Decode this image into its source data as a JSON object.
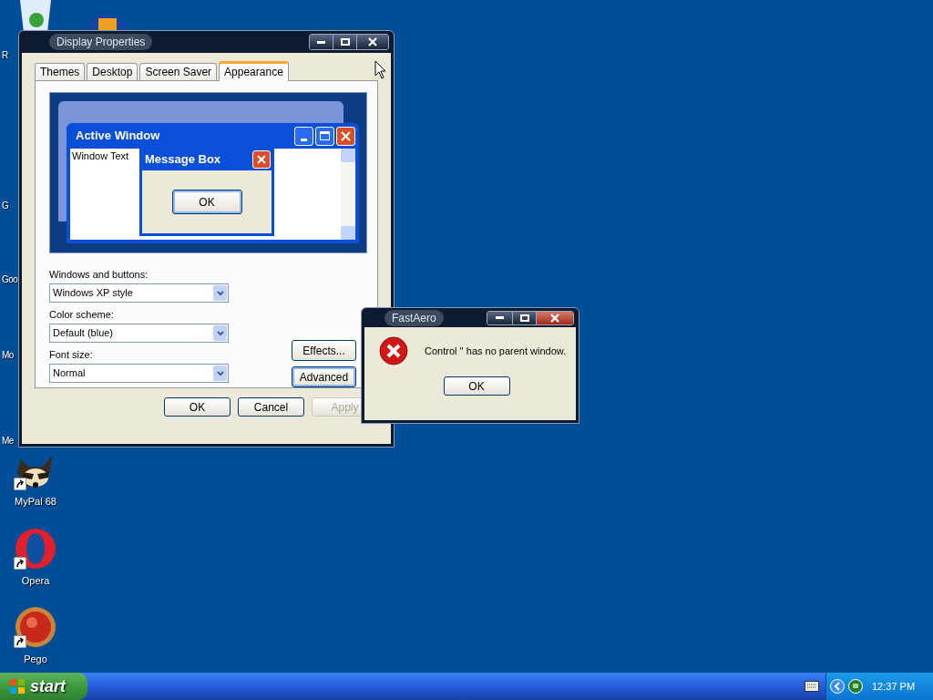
{
  "desktop_icons": [
    {
      "label": "R",
      "kind": "partial"
    },
    {
      "label": "G",
      "kind": "partial"
    },
    {
      "label": "Goo",
      "kind": "partial"
    },
    {
      "label": "Mo",
      "kind": "partial"
    },
    {
      "label": "Me",
      "kind": "partial"
    },
    {
      "label": "MyPal 68",
      "kind": "raccoon"
    },
    {
      "label": "Opera",
      "kind": "opera"
    },
    {
      "label": "Pego",
      "kind": "pego"
    }
  ],
  "display_properties": {
    "title": "Display Properties",
    "tabs": [
      {
        "label": "Themes",
        "selected": false
      },
      {
        "label": "Desktop",
        "selected": false
      },
      {
        "label": "Screen Saver",
        "selected": false
      },
      {
        "label": "Appearance",
        "selected": true
      }
    ],
    "preview": {
      "active_title": "Active Window",
      "window_text": "Window Text",
      "message_box_title": "Message Box",
      "message_box_button": "OK"
    },
    "fields": [
      {
        "label": "Windows and buttons:",
        "value": "Windows XP style"
      },
      {
        "label": "Color scheme:",
        "value": "Default (blue)"
      },
      {
        "label": "Font size:",
        "value": "Normal"
      }
    ],
    "side_buttons": [
      {
        "label": "Effects...",
        "focused": false
      },
      {
        "label": "Advanced",
        "focused": true
      }
    ],
    "buttons": [
      {
        "label": "OK",
        "disabled": false
      },
      {
        "label": "Cancel",
        "disabled": false
      },
      {
        "label": "Apply",
        "disabled": true
      }
    ]
  },
  "error_dialog": {
    "title": "FastAero",
    "message": "Control '' has no parent window.",
    "button": "OK"
  },
  "taskbar": {
    "start": "start",
    "clock": "12:37 PM"
  }
}
